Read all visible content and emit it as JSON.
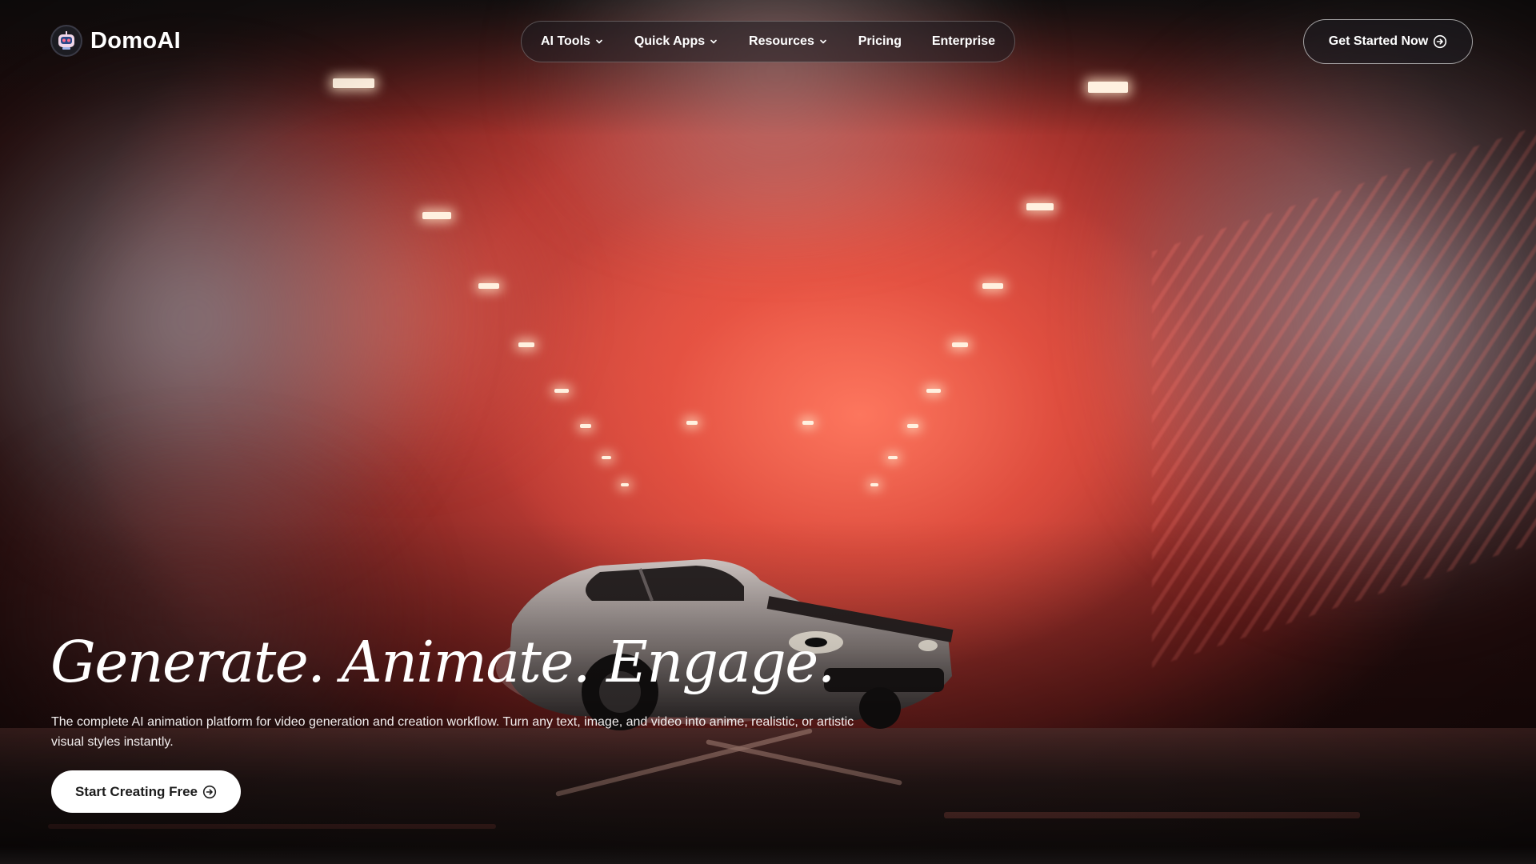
{
  "brand": {
    "name": "DomoAI",
    "logo_icon": "robot-face-logo"
  },
  "nav": {
    "items": [
      {
        "label": "AI Tools",
        "has_dropdown": true
      },
      {
        "label": "Quick Apps",
        "has_dropdown": true
      },
      {
        "label": "Resources",
        "has_dropdown": true
      },
      {
        "label": "Pricing",
        "has_dropdown": false
      },
      {
        "label": "Enterprise",
        "has_dropdown": false
      }
    ],
    "dropdown_icon": "chevron-down-icon"
  },
  "header_cta": {
    "label": "Get Started Now",
    "icon": "circle-arrow-right-icon"
  },
  "hero": {
    "headline": "Generate. Animate. Engage.",
    "subtitle": "The complete AI animation platform for video generation and creation workflow. Turn any text, image, and video into anime, realistic, or artistic visual styles instantly.",
    "cta_label": "Start Creating Free",
    "cta_icon": "circle-arrow-right-icon",
    "background_description_icon": "car-drift-smoke-background"
  },
  "colors": {
    "accent_smoke": "#e35a4c",
    "nav_bg": "#1e1c20",
    "cta_bg": "#ffffff",
    "text": "#ffffff"
  }
}
